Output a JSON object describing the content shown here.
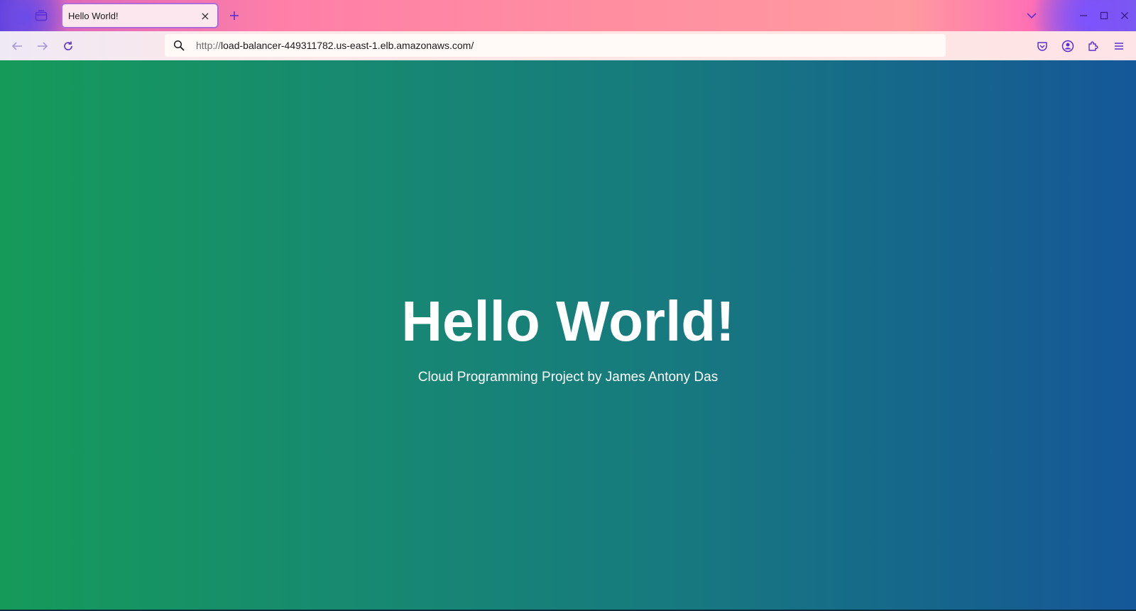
{
  "browser": {
    "tab": {
      "title": "Hello World!",
      "close": "×"
    },
    "url": {
      "scheme": "http://",
      "rest": "load-balancer-449311782.us-east-1.elb.amazonaws.com/"
    },
    "colors": {
      "icon_purple": "#5a2fd1",
      "tab_bg": "#fde7ef",
      "url_bg": "#fffaf8"
    },
    "icons": [
      "tab-groups-icon",
      "plus-icon",
      "chevron-down-icon",
      "minimize-icon",
      "maximize-icon",
      "close-icon",
      "back-arrow-icon",
      "forward-arrow-icon",
      "reload-icon",
      "search-icon",
      "pocket-icon",
      "account-icon",
      "extensions-icon",
      "hamburger-menu-icon"
    ]
  },
  "page": {
    "title": "Hello World!",
    "subtitle": "Cloud Programming Project by James Antony Das",
    "gradient": {
      "start": "#169a5a",
      "end": "#15589a"
    }
  }
}
